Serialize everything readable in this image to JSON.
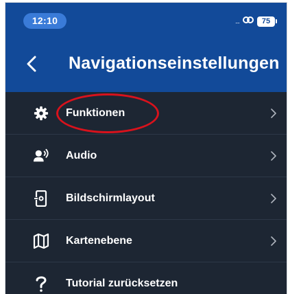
{
  "status_bar": {
    "time": "12:10",
    "signal": "....",
    "battery_level": "75"
  },
  "header": {
    "title": "Navigationseinstellungen",
    "back_icon": "chevron-left-icon"
  },
  "menu": {
    "items": [
      {
        "label": "Funktionen",
        "icon": "gear-icon",
        "has_chevron": true
      },
      {
        "label": "Audio",
        "icon": "speaker-person-icon",
        "has_chevron": true
      },
      {
        "label": "Bildschirmlayout",
        "icon": "phone-layout-icon",
        "has_chevron": true
      },
      {
        "label": "Kartenebene",
        "icon": "map-icon",
        "has_chevron": true
      },
      {
        "label": "Tutorial zurücksetzen",
        "icon": "question-icon",
        "has_chevron": false
      }
    ]
  },
  "annotation": {
    "color": "#d8121c",
    "target": "Funktionen"
  },
  "colors": {
    "header_blue": "#124a99",
    "time_pill": "#3a7bd8",
    "background": "#1d2633"
  }
}
